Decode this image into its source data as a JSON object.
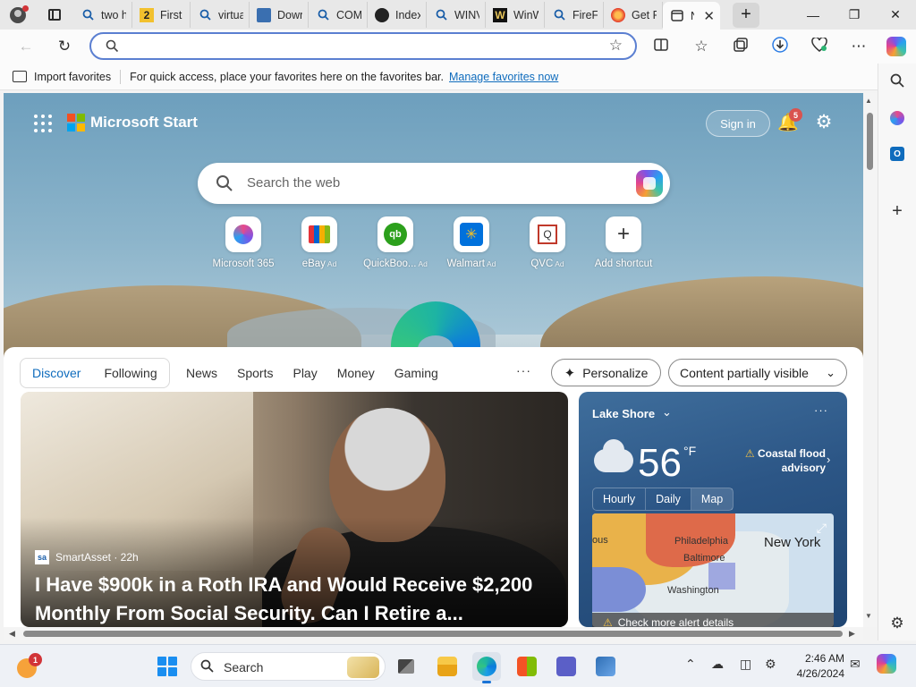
{
  "browser": {
    "tabs": [
      {
        "title": "two h",
        "icon": "search-icon"
      },
      {
        "title": "First t",
        "icon": "number-two-icon",
        "icon_text": "2"
      },
      {
        "title": "virtua",
        "icon": "search-icon"
      },
      {
        "title": "Down",
        "icon": "document-icon"
      },
      {
        "title": "COMP",
        "icon": "search-icon"
      },
      {
        "title": "Index",
        "icon": "github-icon"
      },
      {
        "title": "WINV",
        "icon": "search-icon"
      },
      {
        "title": "WinW",
        "icon": "winworld-icon",
        "icon_text": "W"
      },
      {
        "title": "FireFo",
        "icon": "search-icon"
      },
      {
        "title": "Get Fi",
        "icon": "firefox-icon"
      },
      {
        "title": "N",
        "icon": "newtab-icon",
        "active": true
      }
    ],
    "close_tab": "✕",
    "new_tab": "+",
    "window_controls": {
      "minimize": "—",
      "maximize": "❐",
      "close": "✕"
    },
    "address_placeholder": "",
    "address_value": ""
  },
  "favorites_bar": {
    "import_label": "Import favorites",
    "message": "For quick access, place your favorites here on the favorites bar.",
    "link": "Manage favorites now"
  },
  "ms_start": {
    "title": "Microsoft Start",
    "sign_in": "Sign in",
    "notification_count": "5",
    "search_placeholder": "Search the web",
    "shortcuts": [
      {
        "label": "Microsoft 365",
        "ad": "",
        "icon": "m365-icon"
      },
      {
        "label": "eBay",
        "ad": "Ad",
        "icon": "ebay-icon"
      },
      {
        "label": "QuickBoo...",
        "ad": "Ad",
        "icon": "quickbooks-icon"
      },
      {
        "label": "Walmart",
        "ad": "Ad",
        "icon": "walmart-icon"
      },
      {
        "label": "QVC",
        "ad": "Ad",
        "icon": "qvc-icon"
      },
      {
        "label": "Add shortcut",
        "ad": "",
        "icon": "plus-icon"
      }
    ],
    "feed_tabs": [
      "Discover",
      "Following"
    ],
    "feed_links": [
      "News",
      "Sports",
      "Play",
      "Money",
      "Gaming"
    ],
    "more": "···",
    "personalize": "Personalize",
    "content_visibility": "Content partially visible"
  },
  "hero": {
    "source_logo": "sa",
    "source": "SmartAsset · 22h",
    "headline": "I Have $900k in a Roth IRA and Would Receive $2,200 Monthly From Social Security. Can I Retire a..."
  },
  "weather": {
    "location": "Lake Shore",
    "temperature": "56",
    "unit": "°F",
    "alert": "Coastal flood advisory",
    "tabs": [
      "Hourly",
      "Daily",
      "Map"
    ],
    "selected_tab": "Map",
    "map_labels": [
      "Philadelphia",
      "Baltimore",
      "Washington",
      "New York",
      "ous"
    ],
    "alert_details": "Check more alert details"
  },
  "taskbar": {
    "weather_badge": "1",
    "search_label": "Search",
    "time": "2:46 AM",
    "date": "4/26/2024"
  },
  "colors": {
    "accent": "#0f6cbd",
    "address_border": "#5b7fd1",
    "notification": "#d9534f",
    "weather_bg": "#2c5686"
  }
}
